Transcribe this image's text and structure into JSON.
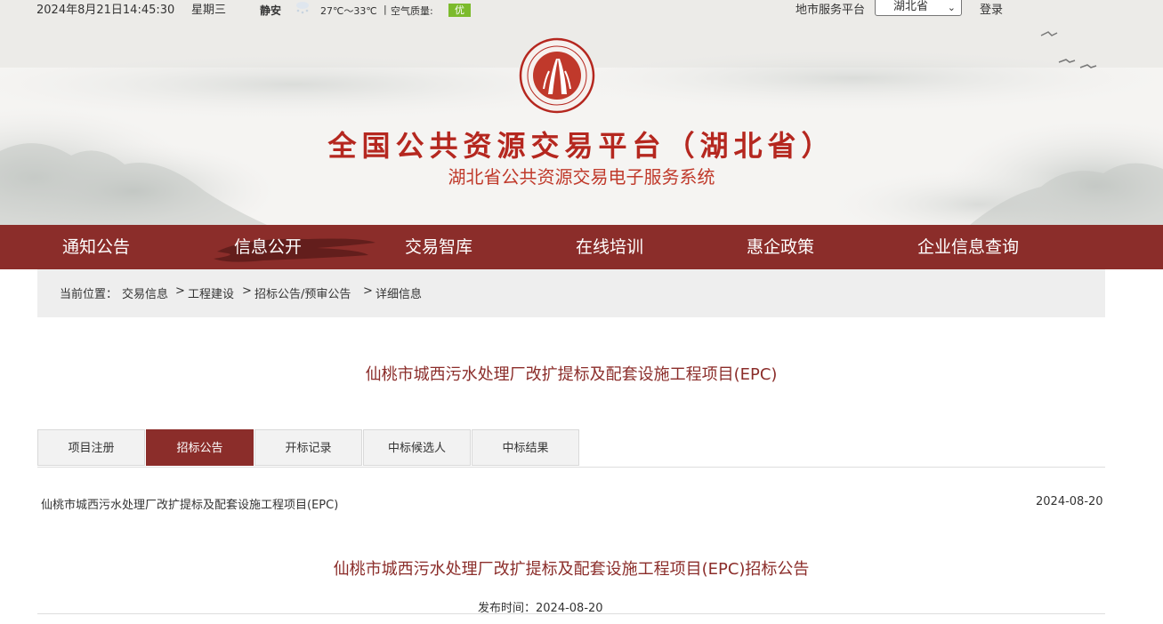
{
  "topbar": {
    "datetime": "2024年8月21日14:45:30",
    "weekday": "星期三",
    "city": "静安",
    "weather_icon": "snow-cloud-icon",
    "temperature": "27℃～33℃",
    "separator": "|",
    "air_quality_label": "空气质量:",
    "air_quality": "优",
    "air_quality_color": "#7cbb2c",
    "city_platform_label": "地市服务平台",
    "province_select": "湖北省",
    "login": "登录"
  },
  "header": {
    "logo_icon": "public-resource-trading-seal-logo",
    "title": "全国公共资源交易平台（湖北省）",
    "subtitle": "湖北省公共资源交易电子服务系统"
  },
  "nav": {
    "items": [
      "通知公告",
      "信息公开",
      "交易智库",
      "在线培训",
      "惠企政策",
      "企业信息查询"
    ],
    "active": "信息公开",
    "color": "#8b2d2a"
  },
  "breadcrumb": {
    "label": "当前位置：",
    "items": [
      "交易信息",
      "工程建设",
      "招标公告/预审公告",
      "详细信息"
    ],
    "separator": ">"
  },
  "project": {
    "title": "仙桃市城西污水处理厂改扩提标及配套设施工程项目(EPC)"
  },
  "tabs": {
    "items": [
      "项目注册",
      "招标公告",
      "开标记录",
      "中标候选人",
      "中标结果"
    ],
    "active": "招标公告"
  },
  "listing": {
    "title": "仙桃市城西污水处理厂改扩提标及配套设施工程项目(EPC)",
    "date": "2024-08-20"
  },
  "notice": {
    "title": "仙桃市城西污水处理厂改扩提标及配套设施工程项目(EPC)招标公告",
    "publish_label": "发布时间：",
    "publish_date": "2024-08-20"
  }
}
